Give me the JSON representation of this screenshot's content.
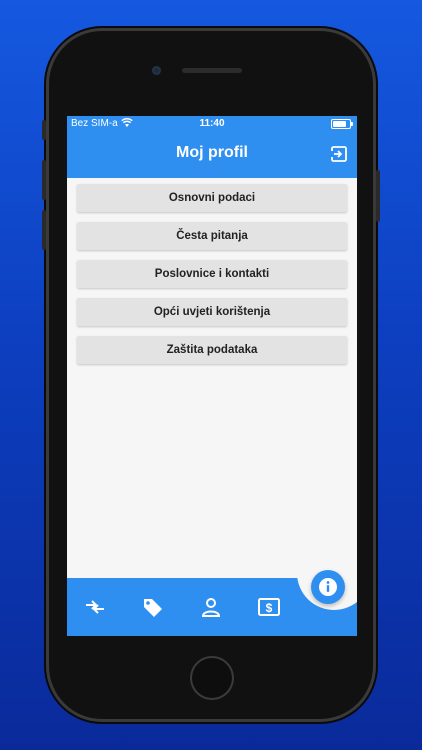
{
  "status": {
    "carrier": "Bez SIM-a",
    "time": "11:40"
  },
  "header": {
    "title": "Moj profil",
    "logout_icon": "logout-icon"
  },
  "menu": {
    "items": [
      {
        "label": "Osnovni podaci"
      },
      {
        "label": "Česta pitanja"
      },
      {
        "label": "Poslovnice i kontakti"
      },
      {
        "label": "Opći uvjeti korištenja"
      },
      {
        "label": "Zaštita podataka"
      }
    ]
  },
  "bottom_nav": {
    "tabs": [
      {
        "icon": "transfer-icon"
      },
      {
        "icon": "tag-icon"
      },
      {
        "icon": "profile-icon"
      },
      {
        "icon": "money-icon"
      }
    ],
    "fab_icon": "info-icon"
  },
  "colors": {
    "accent": "#2f8ff0",
    "background": "#f6f6f6",
    "menu_item": "#e3e3e3"
  }
}
